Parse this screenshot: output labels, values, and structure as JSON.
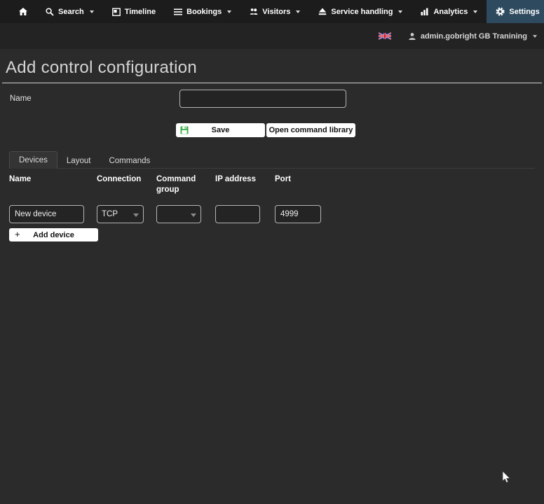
{
  "colors": {
    "navbar_bg": "#1c1c1c",
    "userbar_bg": "#232323",
    "content_bg": "#2b2b2b",
    "settings_active_bg": "#2d4a5f",
    "button_bg": "#ffffff",
    "button_text": "#111111",
    "save_icon_green": "#3fae49",
    "input_border": "#b5b5b5"
  },
  "navbar": {
    "items": [
      {
        "label": "",
        "icon": "home-icon",
        "has_caret": false
      },
      {
        "label": "Search",
        "icon": "search-icon",
        "has_caret": true
      },
      {
        "label": "Timeline",
        "icon": "calendar-icon",
        "has_caret": false
      },
      {
        "label": "Bookings",
        "icon": "list-icon",
        "has_caret": true
      },
      {
        "label": "Visitors",
        "icon": "people-icon",
        "has_caret": true
      },
      {
        "label": "Service handling",
        "icon": "eject-icon",
        "has_caret": true
      },
      {
        "label": "Analytics",
        "icon": "bar-chart-icon",
        "has_caret": true
      },
      {
        "label": "Settings",
        "icon": "gear-icon",
        "has_caret": true,
        "active": true
      }
    ]
  },
  "userbar": {
    "flag_icon": "uk-flag-icon",
    "user_icon": "person-icon",
    "user_label": "admin.gobright GB Tranining"
  },
  "page": {
    "title": "Add control configuration"
  },
  "form": {
    "name_label": "Name",
    "name_value": "",
    "save_label": "Save",
    "open_command_library_label": "Open command library"
  },
  "tabs": [
    {
      "label": "Devices",
      "active": true
    },
    {
      "label": "Layout",
      "active": false
    },
    {
      "label": "Commands",
      "active": false
    }
  ],
  "devices_table": {
    "headers": [
      "Name",
      "Connection",
      "Command group",
      "IP address",
      "Port"
    ],
    "row": {
      "name": "New device",
      "connection": "TCP",
      "command_group": "",
      "ip_address": "",
      "port": "4999"
    },
    "plus_label": "+",
    "add_device_label": "Add device"
  }
}
